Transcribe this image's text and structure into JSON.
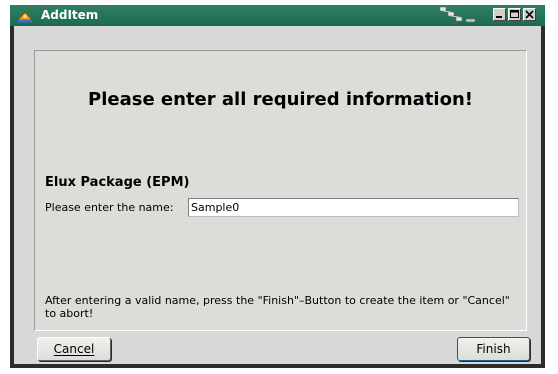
{
  "window": {
    "title": "AddItem",
    "icons": {
      "app": "app-logo-icon",
      "network": "network-status-icon"
    },
    "controls": [
      "minimize-icon",
      "maximize-icon",
      "close-icon"
    ]
  },
  "dialog": {
    "heading": "Please enter all required information!",
    "section_title": "Elux Package (EPM)",
    "name_label": "Please enter the name:",
    "name_value": "Sample0",
    "hint": "After entering a valid name, press the \"Finish\"–Button to create the item or \"Cancel\" to abort!",
    "cancel_label": "Cancel",
    "finish_label": "Finish"
  },
  "colors": {
    "titlebar": "#2f7f62",
    "window_frame": "#2c2c2c",
    "client_bg": "#d8d8d8",
    "panel_bg": "#dddcd9"
  }
}
